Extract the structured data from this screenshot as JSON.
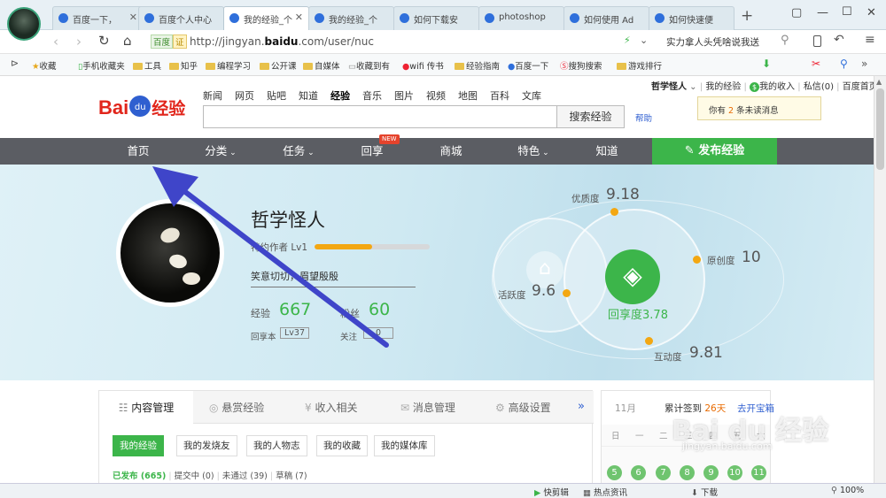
{
  "browser": {
    "tabs": [
      {
        "label": "百度一下，"
      },
      {
        "label": "百度个人中心"
      },
      {
        "label": "我的经验_个"
      },
      {
        "label": "我的经验_个"
      },
      {
        "label": "如何下载安"
      },
      {
        "label": "photoshop"
      },
      {
        "label": "如何使用 Ad"
      },
      {
        "label": "如何快速便"
      }
    ],
    "new_tab": "+",
    "win_controls": [
      "▢",
      "—",
      "☐",
      "✕"
    ],
    "address": {
      "badge": "百度",
      "badge2": "证",
      "prefix": "http://jingyan.",
      "domain": "baidu",
      "suffix": ".com/user/nuc"
    },
    "search_box": "实力拿人头凭啥说我送",
    "bookmarks": [
      "收藏",
      "手机收藏夹",
      "工具",
      "知乎",
      "编程学习",
      "公开课",
      "自媒体",
      "收藏到有",
      "wifi 传书",
      "经验指南",
      "百度一下",
      "搜狗搜索",
      "游戏排行"
    ],
    "status": [
      "快剪辑",
      "热点资讯",
      "下载",
      "100%"
    ]
  },
  "site": {
    "logo": {
      "bai": "Bai",
      "du": "du",
      "jingyan": "经验"
    },
    "top_links": [
      "新闻",
      "网页",
      "贴吧",
      "知道",
      "经验",
      "音乐",
      "图片",
      "视频",
      "地图",
      "百科",
      "文库"
    ],
    "search_button": "搜索经验",
    "help": "帮助",
    "user_links": {
      "user": "哲学怪人",
      "my_jingyan": "我的经验",
      "income": "我的收入",
      "private": "私信",
      "private_count": "(0)",
      "home": "百度首页"
    },
    "popup": {
      "pre": "你有 ",
      "count": "2",
      "post": " 条未读消息"
    },
    "nav": [
      "首页",
      "分类",
      "任务",
      "回享",
      "商城",
      "特色",
      "知道"
    ],
    "nav_new": "NEW",
    "publish": "发布经验"
  },
  "profile": {
    "name": "哲学怪人",
    "level_label": "特约作者 Lv1",
    "level_progress": 0.5,
    "motto": "笑意切切，眉望殷殷",
    "jingyan_label": "经验",
    "jingyan_value": "667",
    "fans_label": "粉丝",
    "fans_value": "60",
    "huixiang_label": "回享本",
    "huixiang_value": "Lv37",
    "follow_label": "关注",
    "follow_value": "0"
  },
  "stats": {
    "youzhi_label": "优质度",
    "youzhi": "9.18",
    "yuanchuang_label": "原创度",
    "yuanchuang": "10",
    "huoyue_label": "活跃度",
    "huoyue": "9.6",
    "hudong_label": "互动度",
    "hudong": "9.81",
    "huixiang_label": "回享度",
    "huixiang": "3.78"
  },
  "content": {
    "tabs": [
      "内容管理",
      "悬赏经验",
      "收入相关",
      "消息管理",
      "高级设置"
    ],
    "more": "»",
    "subtabs": [
      "我的经验",
      "我的发烧友",
      "我的人物志",
      "我的收藏",
      "我的媒体库"
    ],
    "filter": {
      "published": "已发布",
      "published_count": "(665)",
      "pending": "提交中 (0)",
      "rejected": "未通过 (39)",
      "draft": "草稿 (7)"
    }
  },
  "calendar": {
    "month": "11月",
    "signin_pre": "累计签到 ",
    "signin_days": "26天",
    "signin_link": "去开宝箱",
    "weekdays": [
      "日",
      "一",
      "二",
      "三",
      "四",
      "五",
      "六"
    ],
    "days": [
      "5",
      "6",
      "7",
      "8",
      "9",
      "10",
      "11"
    ]
  },
  "watermark": "Bai du 经验",
  "watermark_url": "jingyan.baidu.com",
  "colors": {
    "accent_green": "#3cb54a",
    "nav_bg": "#5b5d63",
    "logo_red": "#e1251b",
    "logo_blue": "#2f5fd0",
    "arrow": "#3f45c9"
  }
}
